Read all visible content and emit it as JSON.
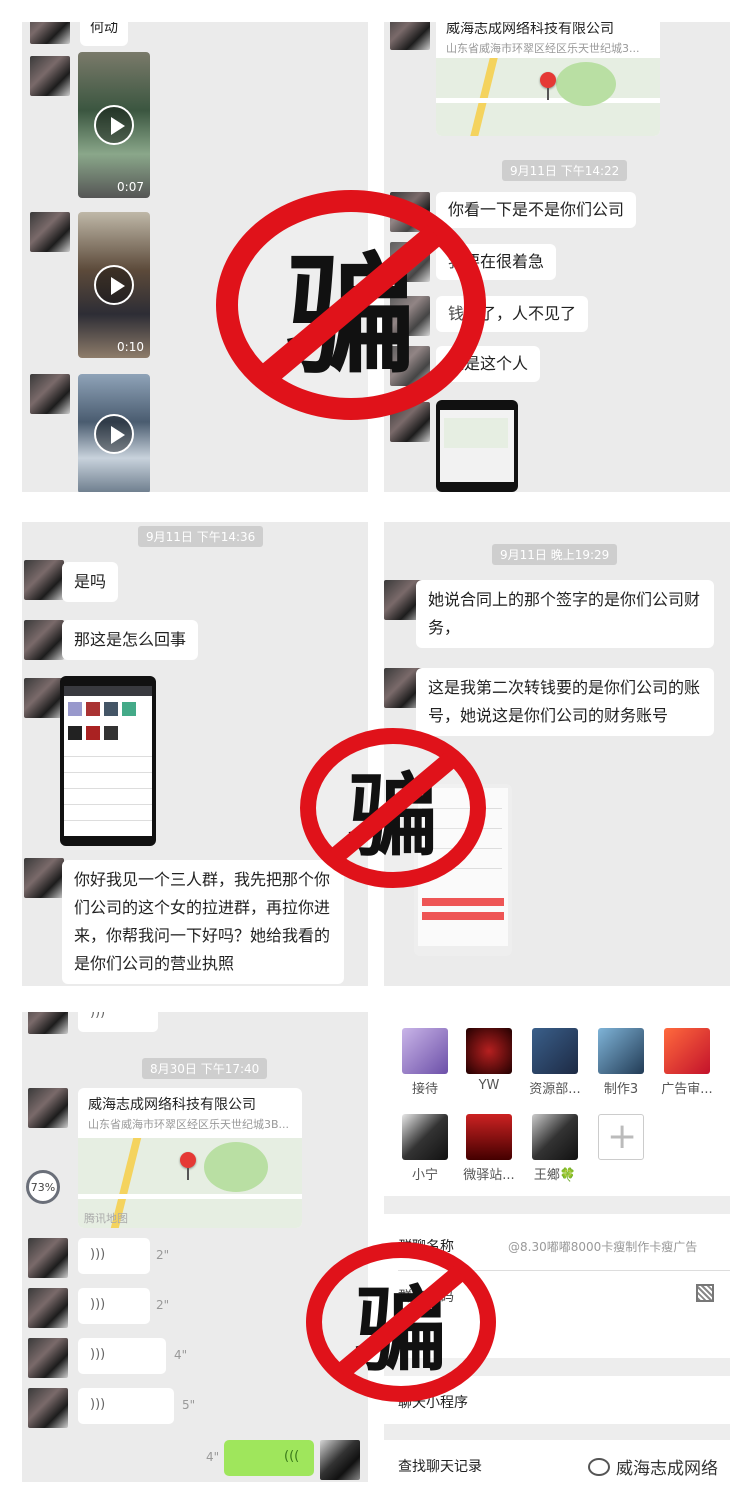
{
  "panel1": {
    "top_fragment": "何动",
    "videos": [
      {
        "duration": "0:07"
      },
      {
        "duration": "0:10"
      },
      {
        "duration": ""
      }
    ]
  },
  "panel2": {
    "top_card_title": "威海志成网络科技有限公司",
    "top_card_addr": "山东省威海市环翠区经区乐天世纪城3...",
    "timestamp": "9月11日 下午14:22",
    "messages": [
      "你看一下是不是你们公司",
      "我要在很着急",
      "钱交了，人不见了",
      "就是这个人"
    ]
  },
  "panel3": {
    "timestamp": "9月11日 下午14:36",
    "messages": [
      "是吗",
      "那这是怎么回事"
    ],
    "long_message": "你好我见一个三人群，我先把那个你们公司的这个女的拉进群，再拉你进来，你帮我问一下好吗？她给我看的是你们公司的营业执照"
  },
  "panel4": {
    "timestamp": "9月11日 晚上19:29",
    "msg1": "她说合同上的那个签字的是你们公司财务，",
    "msg2": "这是我第二次转钱要的是你们公司的账号，她说这是你们公司的财务账号"
  },
  "panel5": {
    "timestamp": "8月30日 下午17:40",
    "loc_title": "威海志成网络科技有限公司",
    "loc_addr": "山东省威海市环翠区经区乐天世纪城3B...",
    "progress": "73%",
    "voices": [
      {
        "len": "2\""
      },
      {
        "len": "2\""
      },
      {
        "len": "4\""
      },
      {
        "len": "5\""
      }
    ],
    "self_voice_len": "4\"",
    "map_label": "腾讯地图"
  },
  "panel6": {
    "members_row1": [
      "接待",
      "YW",
      "资源部...",
      "制作3",
      "广告审..."
    ],
    "members_row2": [
      "小宁",
      "微驿站...",
      "王鄉🍀"
    ],
    "group_name_label": "群聊名称",
    "group_name_value": "@8.30嘟嘟8000卡瘦制作卡瘦广告",
    "qr_label": "群二维码",
    "mini_program_label": "聊天小程序",
    "search_label": "查找聊天记录"
  },
  "stamp_char": "骗",
  "watermark": "威海志成网络",
  "colors": {
    "stamp_red": "#e0121a",
    "wechat_green": "#9fe65c"
  }
}
